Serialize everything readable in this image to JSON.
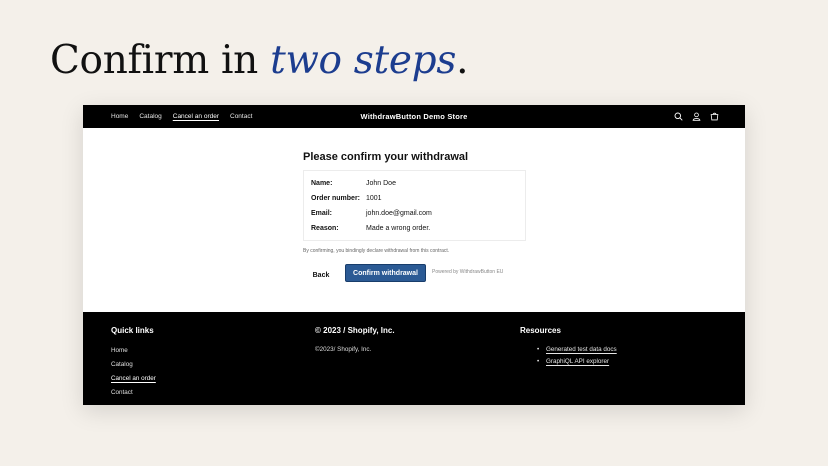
{
  "headline": {
    "part1": "Confirm in",
    "accent": "two steps",
    "end": "."
  },
  "topnav": {
    "links": [
      {
        "label": "Home"
      },
      {
        "label": "Catalog"
      },
      {
        "label": "Cancel an order"
      },
      {
        "label": "Contact"
      }
    ],
    "store_title": "WithdrawButton Demo Store",
    "icons": [
      "search-icon",
      "account-icon",
      "cart-icon"
    ]
  },
  "form": {
    "title": "Please confirm your withdrawal",
    "rows": [
      {
        "label": "Name:",
        "value": "John Doe"
      },
      {
        "label": "Order number:",
        "value": "1001"
      },
      {
        "label": "Email:",
        "value": "john.doe@gmail.com"
      },
      {
        "label": "Reason:",
        "value": "Made a wrong order."
      }
    ],
    "consent_text": "By confirming, you bindingly declare withdrawal from this contract.",
    "back_label": "Back",
    "confirm_label": "Confirm withdrawal",
    "powered_by": "Powered by WithdrawButton EU"
  },
  "footer": {
    "quick_links_title": "Quick links",
    "quick_links": [
      {
        "label": "Home"
      },
      {
        "label": "Catalog"
      },
      {
        "label": "Cancel an order"
      },
      {
        "label": "Contact"
      }
    ],
    "copyright_title": "© 2023 / Shopify, Inc.",
    "copyright_text": "©2023/ Shopify, Inc.",
    "resources_title": "Resources",
    "resources": [
      {
        "label": "Generated test data docs"
      },
      {
        "label": "GraphiQL API explorer"
      }
    ]
  },
  "colors": {
    "accent": "#1c3d8f",
    "button": "#2b5a94",
    "background": "#f4f0ea"
  }
}
